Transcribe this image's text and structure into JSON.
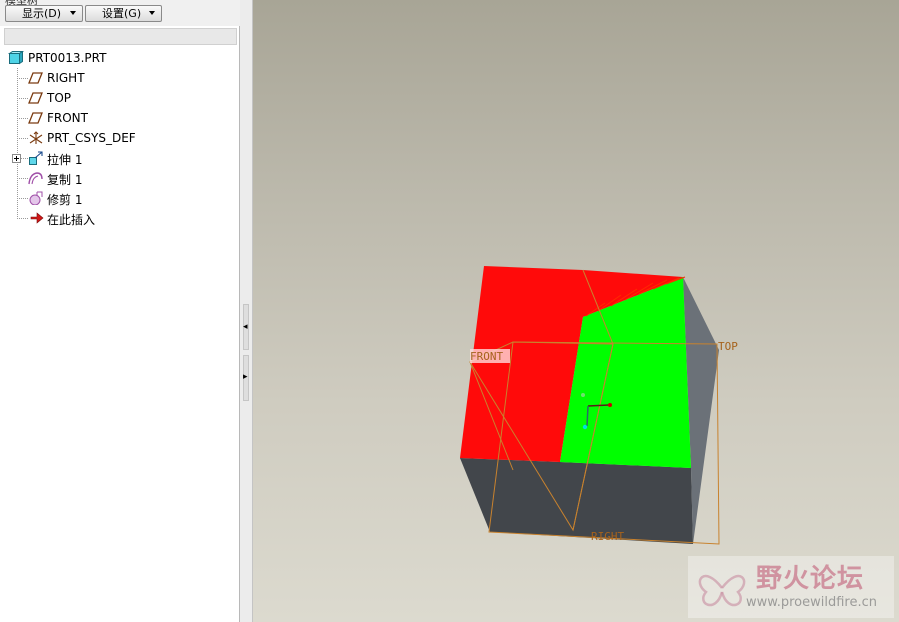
{
  "panel": {
    "cut_title": "模型树",
    "display_button": "显示(D)",
    "settings_button": "设置(G)"
  },
  "tree": {
    "root": "PRT0013.PRT",
    "items": [
      {
        "label": "RIGHT",
        "icon": "datum-plane-icon"
      },
      {
        "label": "TOP",
        "icon": "datum-plane-icon"
      },
      {
        "label": "FRONT",
        "icon": "datum-plane-icon"
      },
      {
        "label": "PRT_CSYS_DEF",
        "icon": "coordinate-system-icon"
      },
      {
        "label": "拉伸 1",
        "icon": "extrude-icon",
        "expandable": true
      },
      {
        "label": "复制 1",
        "icon": "copy-surface-icon"
      },
      {
        "label": "修剪 1",
        "icon": "trim-icon"
      },
      {
        "label": "在此插入",
        "icon": "insert-here-arrow-icon"
      }
    ]
  },
  "viewport": {
    "planes": {
      "front": "FRONT",
      "top": "TOP",
      "right": "RIGHT"
    },
    "colors": {
      "red_face": "#ff0a0a",
      "green_face": "#00ff00",
      "side_face": "#6b7178",
      "bottom_face": "#42464b",
      "datum_edge": "#c8822e"
    }
  },
  "watermark": {
    "title": "野火论坛",
    "url": "www.proewildfire.cn"
  }
}
